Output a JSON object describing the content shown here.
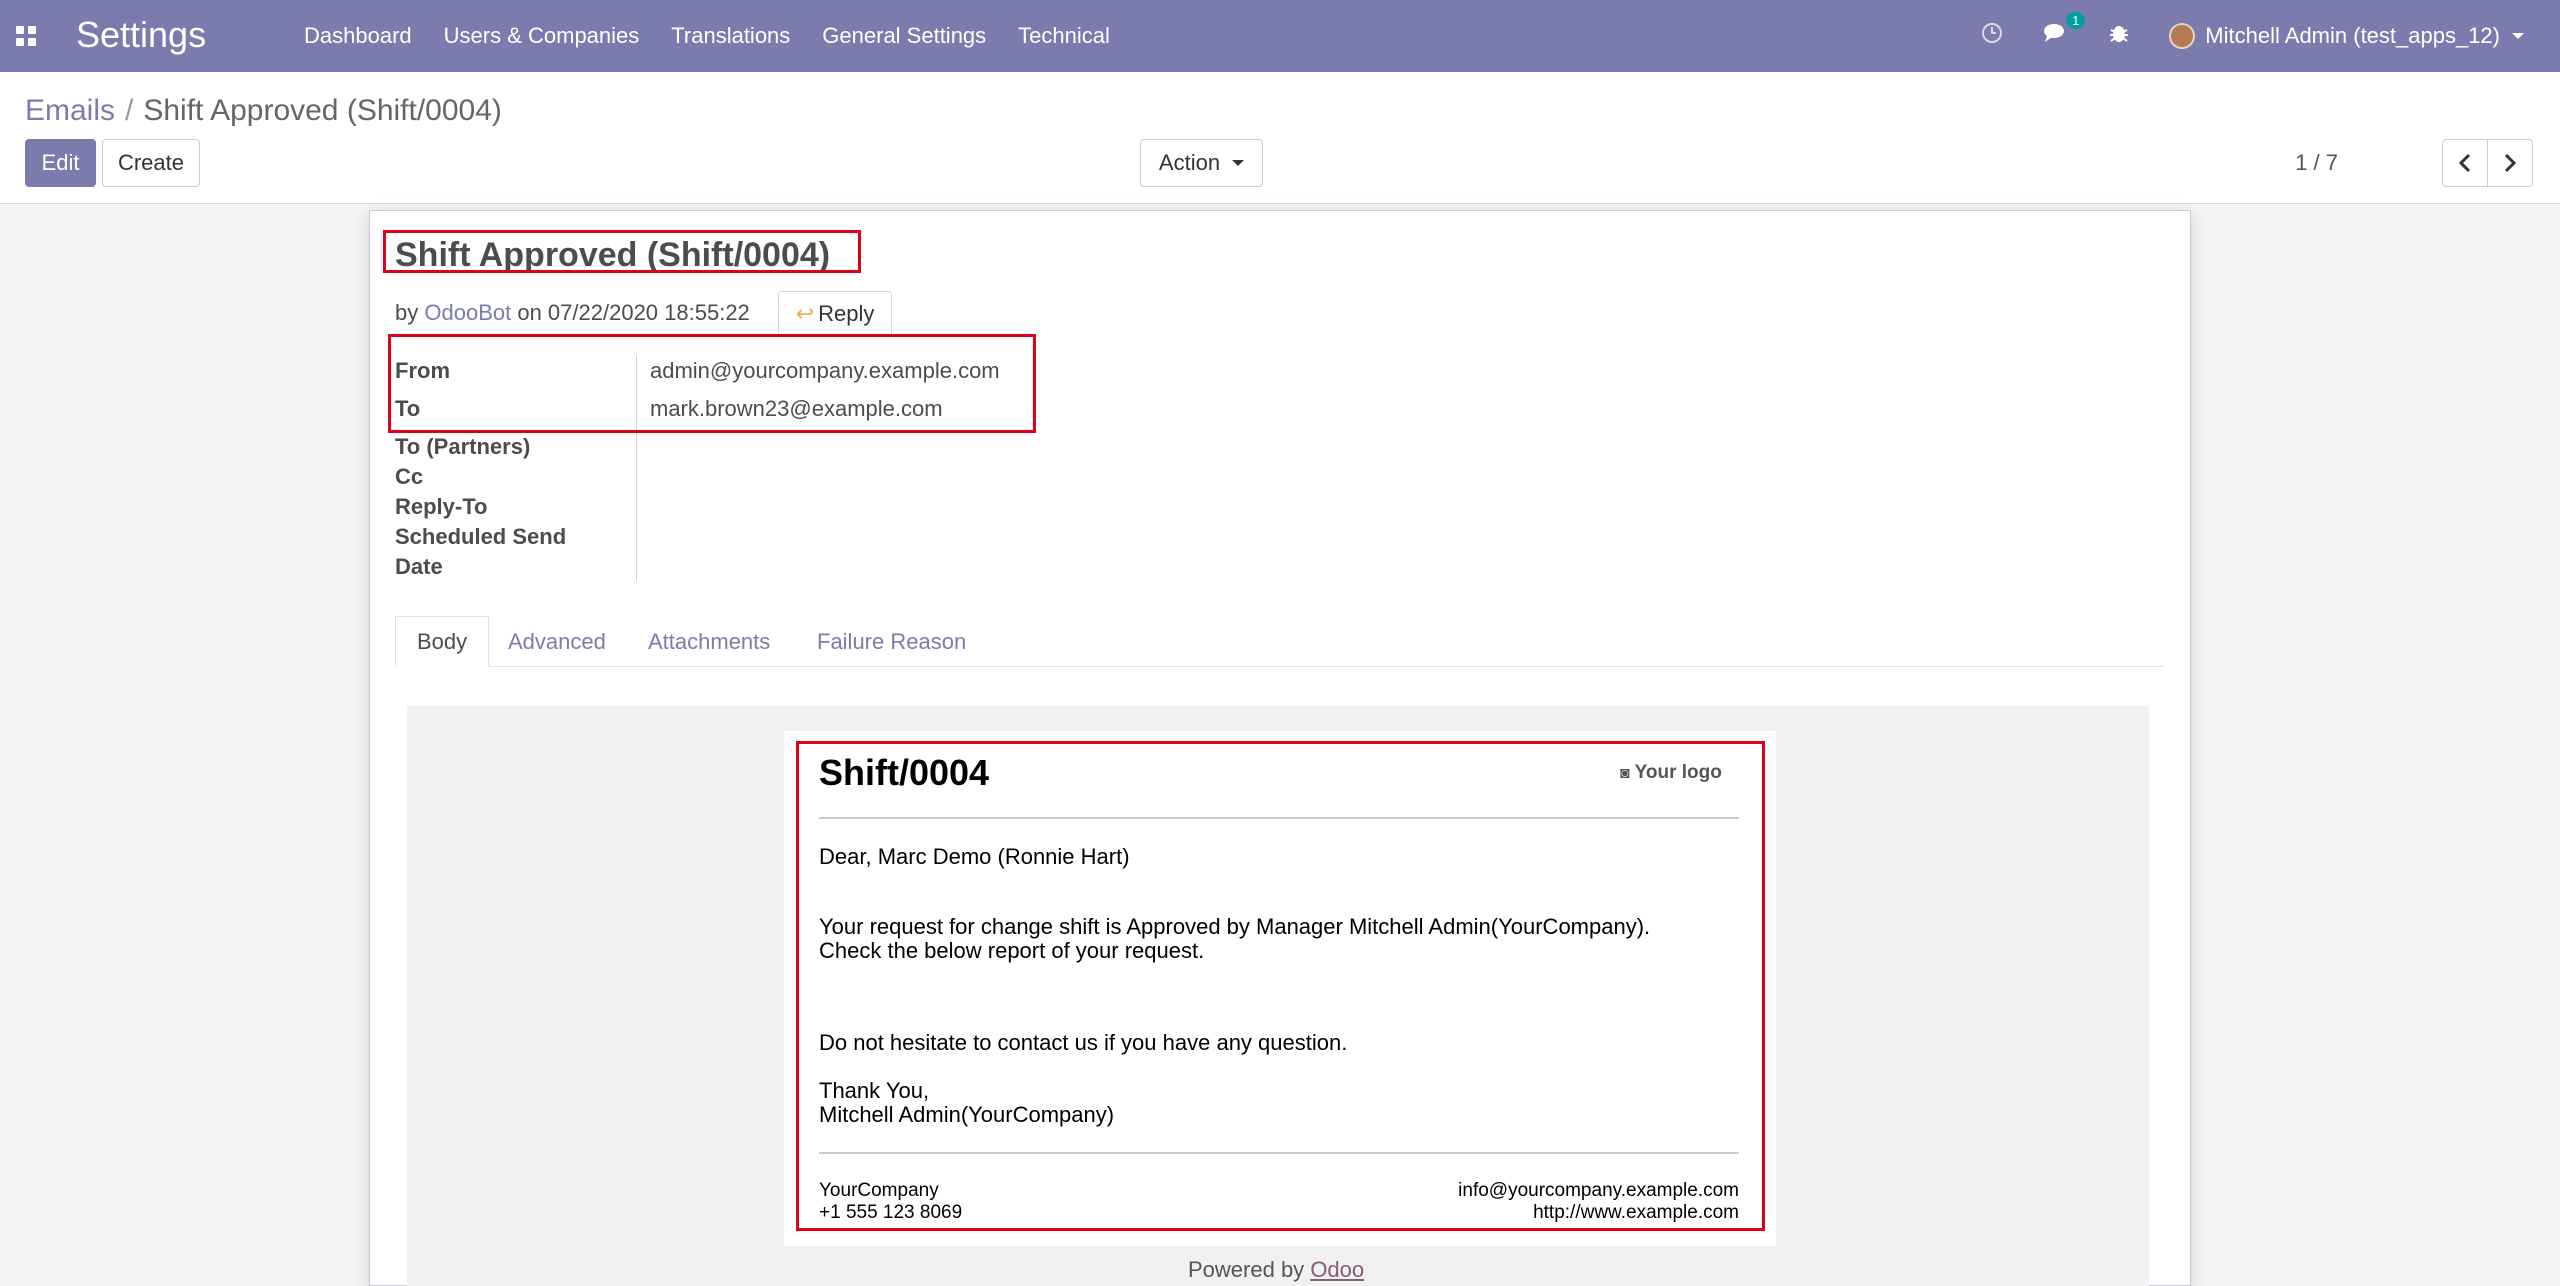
{
  "navbar": {
    "app_title": "Settings",
    "menu": [
      "Dashboard",
      "Users & Companies",
      "Translations",
      "General Settings",
      "Technical"
    ],
    "chat_badge": "1",
    "user_label": "Mitchell Admin (test_apps_12)"
  },
  "control": {
    "breadcrumb_parent": "Emails",
    "breadcrumb_sep": "/",
    "breadcrumb_current": "Shift Approved (Shift/0004)",
    "edit_label": "Edit",
    "create_label": "Create",
    "action_label": "Action",
    "pager": "1 / 7"
  },
  "message": {
    "subject": "Shift Approved (Shift/0004)",
    "by": "by",
    "author": "OdooBot",
    "on": "on 07/22/2020 18:55:22",
    "reply_label": "Reply"
  },
  "fields": [
    {
      "label": "From",
      "value": "admin@yourcompany.example.com"
    },
    {
      "label": "To",
      "value": "mark.brown23@example.com"
    },
    {
      "label": "To (Partners)",
      "value": ""
    },
    {
      "label": "Cc",
      "value": ""
    },
    {
      "label": "Reply-To",
      "value": ""
    },
    {
      "label": "Scheduled Send",
      "value": ""
    },
    {
      "label": "Date",
      "value": ""
    }
  ],
  "tabs": [
    "Body",
    "Advanced",
    "Attachments",
    "Failure Reason"
  ],
  "mail": {
    "title": "Shift/0004",
    "logo": "Your logo",
    "greeting": "Dear, Marc Demo (Ronnie Hart)",
    "para1_line1": "Your request for change shift is Approved by Manager Mitchell Admin(YourCompany).",
    "para1_line2": "Check the below report of your request.",
    "para2": "Do not hesitate to contact us if you have any question.",
    "thanks": "Thank You,",
    "signature": "Mitchell Admin(YourCompany)",
    "company": "YourCompany",
    "phone": "+1 555 123 8069",
    "email": "info@yourcompany.example.com",
    "website": "http://www.example.com",
    "powered_by": "Powered by",
    "odoo": "Odoo"
  },
  "colors": {
    "brand": "#7c7bad",
    "highlight": "#e0001a",
    "badge": "#00a09d"
  }
}
